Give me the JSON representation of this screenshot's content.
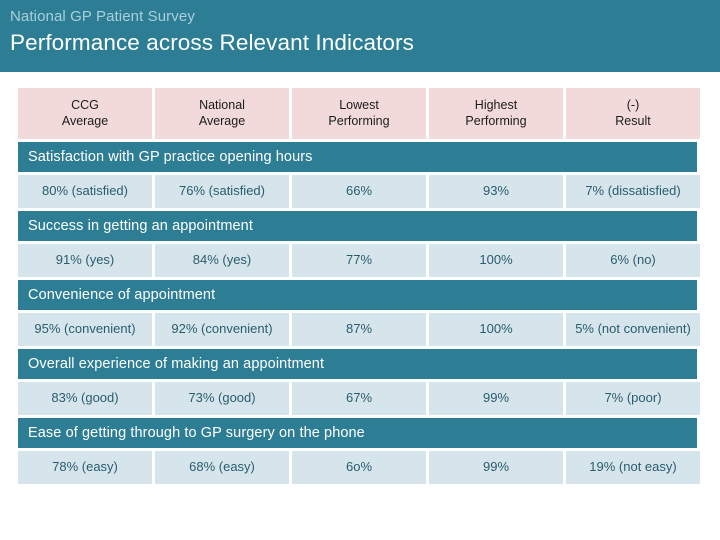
{
  "banner": {
    "subtitle": "National GP Patient Survey",
    "title": "Performance across Relevant Indicators",
    "background_color": "#2d7e95",
    "subtitle_color": "#a9cfdc",
    "title_color": "#ffffff"
  },
  "colors": {
    "header_cell_background": "#f2dadb",
    "section_band_background": "#2d7e95",
    "data_cell_background": "#d6e5eb",
    "data_cell_text": "#2a5c6e"
  },
  "table": {
    "columns": [
      "CCG\nAverage",
      "National\nAverage",
      "Lowest\nPerforming",
      "Highest\nPerforming",
      "(-)\nResult"
    ],
    "columns_flat": [
      {
        "line1": "CCG",
        "line2": "Average"
      },
      {
        "line1": "National",
        "line2": "Average"
      },
      {
        "line1": "Lowest",
        "line2": "Performing"
      },
      {
        "line1": "Highest",
        "line2": "Performing"
      },
      {
        "line1": "(-)",
        "line2": "Result"
      }
    ],
    "sections": [
      {
        "title": "Satisfaction with GP practice opening hours",
        "values": [
          "80% (satisfied)",
          "76% (satisfied)",
          "66%",
          "93%",
          "7% (dissatisfied)"
        ]
      },
      {
        "title": "Success in getting an appointment",
        "values": [
          "91% (yes)",
          "84% (yes)",
          "77%",
          "100%",
          "6% (no)"
        ]
      },
      {
        "title": "Convenience of appointment",
        "values": [
          "95% (convenient)",
          "92% (convenient)",
          "87%",
          "100%",
          "5% (not convenient)"
        ]
      },
      {
        "title": "Overall experience of making an appointment",
        "values": [
          "83% (good)",
          "73% (good)",
          "67%",
          "99%",
          "7% (poor)"
        ]
      },
      {
        "title": "Ease of getting through to GP surgery on the phone",
        "values": [
          "78% (easy)",
          "68% (easy)",
          "6o%",
          "99%",
          "19% (not easy)"
        ]
      }
    ]
  }
}
